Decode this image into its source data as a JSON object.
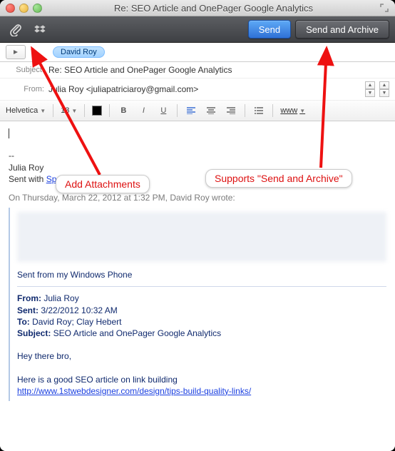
{
  "window": {
    "title": "Re: SEO Article and OnePager Google Analytics"
  },
  "toolbar": {
    "send": "Send",
    "send_archive": "Send and Archive"
  },
  "recipients": {
    "to_name": "David Roy"
  },
  "fields": {
    "subject_label": "Subject:",
    "subject": "Re: SEO Article and OnePager Google Analytics",
    "from_label": "From:",
    "from": "Julia Roy <juliapatriciaroy@gmail.com>"
  },
  "format": {
    "font": "Helvetica",
    "size": "13",
    "www": "www"
  },
  "compose": {
    "sig_dashes": "--",
    "sig_name": "Julia Roy",
    "sig_sent_prefix": "Sent with ",
    "sig_app": "Sparrow",
    "quote_intro": "On Thursday, March 22, 2012 at 1:32 PM, David Roy wrote:",
    "sent_from": "Sent from my Windows Phone",
    "hdr_from_lbl": "From:",
    "hdr_from": " Julia Roy",
    "hdr_sent_lbl": "Sent:",
    "hdr_sent": " 3/22/2012 10:32 AM",
    "hdr_to_lbl": "To:",
    "hdr_to": " David Roy; Clay Hebert",
    "hdr_subj_lbl": "Subject:",
    "hdr_subj": " SEO Article and OnePager Google Analytics",
    "greeting": "Hey there bro,",
    "line1": "Here is a good SEO article on link building",
    "url1": "http://www.1stwebdesigner.com/design/tips-build-quality-links/"
  },
  "callouts": {
    "attach": "Add Attachments",
    "archive": "Supports \"Send and Archive\""
  }
}
